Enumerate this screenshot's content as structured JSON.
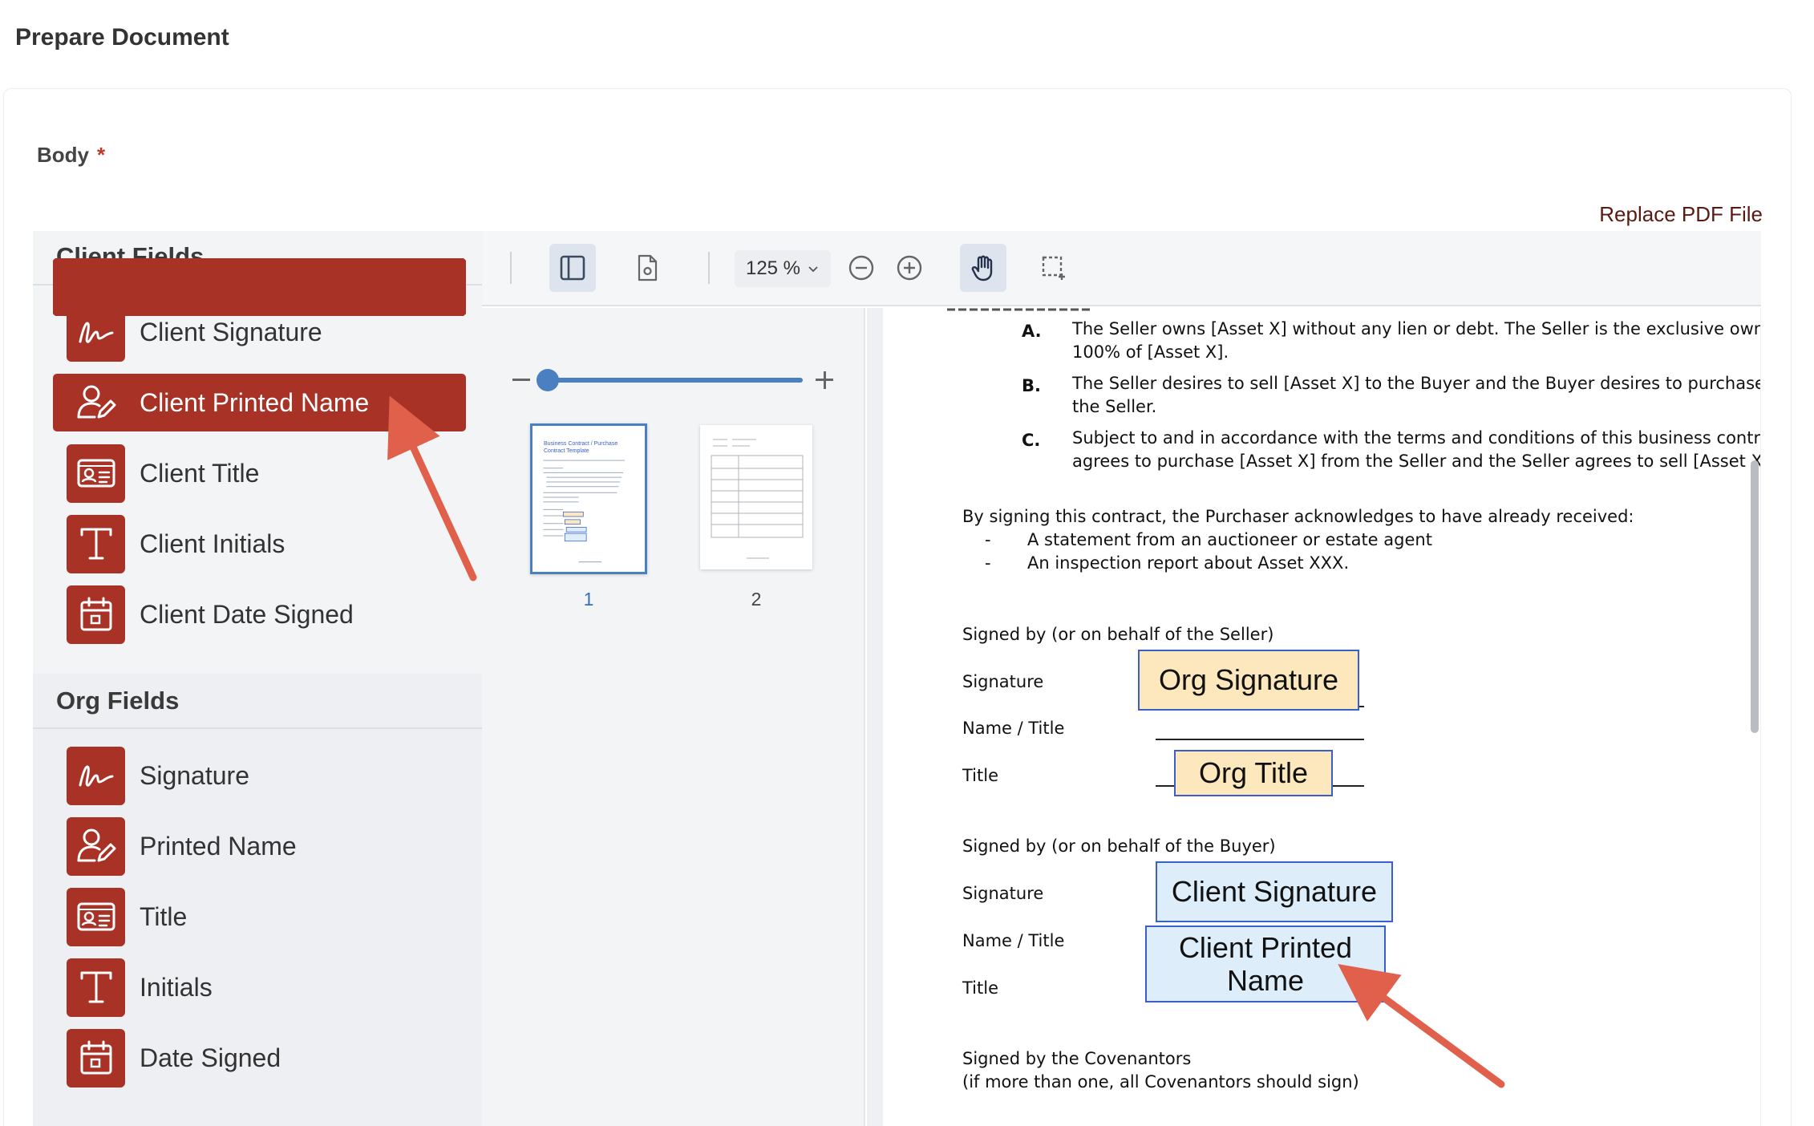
{
  "page": {
    "title": "Prepare Document"
  },
  "form": {
    "body_label": "Body",
    "required_mark": "*",
    "replace_pdf_label": "Replace PDF File"
  },
  "client_fields": {
    "title": "Client Fields",
    "items": [
      {
        "label": "Client Signature",
        "icon": "signature-icon"
      },
      {
        "label": "Client Printed Name",
        "icon": "user-pen-icon",
        "active": true
      },
      {
        "label": "Client Title",
        "icon": "id-card-icon"
      },
      {
        "label": "Client Initials",
        "icon": "text-t-icon"
      },
      {
        "label": "Client Date Signed",
        "icon": "calendar-icon"
      }
    ]
  },
  "org_fields": {
    "title": "Org Fields",
    "items": [
      {
        "label": "Signature",
        "icon": "signature-icon"
      },
      {
        "label": "Printed Name",
        "icon": "user-pen-icon"
      },
      {
        "label": "Title",
        "icon": "id-card-icon"
      },
      {
        "label": "Initials",
        "icon": "text-t-icon"
      },
      {
        "label": "Date Signed",
        "icon": "calendar-icon"
      }
    ]
  },
  "toolbar": {
    "zoom_label": "125 %",
    "icons": [
      "sidebar-toggle-icon",
      "document-settings-icon",
      "zoom-out-icon",
      "zoom-in-icon",
      "hand-pan-icon",
      "marquee-select-icon"
    ]
  },
  "thumbnails": {
    "pages": [
      {
        "number": "1",
        "selected": true,
        "heading": "Business Contract / Purchase Contract Template"
      },
      {
        "number": "2",
        "selected": false
      }
    ]
  },
  "document": {
    "recitals": [
      {
        "letter": "A.",
        "lines": [
          "The Seller owns [Asset X] without any lien or debt. The Seller is the exclusive owner ar",
          "100% of [Asset X]."
        ]
      },
      {
        "letter": "B.",
        "lines": [
          "The Seller desires to sell [Asset X] to the Buyer and the Buyer desires to purchase [Ass",
          "the Seller."
        ]
      },
      {
        "letter": "C.",
        "lines": [
          "Subject to and in accordance with the terms and conditions of this business contract, t",
          "agrees to purchase [Asset X] from the Seller and the Seller agrees to sell [Asset X] to th"
        ]
      }
    ],
    "acknowledge_text": "By signing this contract, the Purchaser acknowledges to have already received:",
    "bullets": [
      "A statement from an auctioneer or estate agent",
      "An inspection report about Asset XXX."
    ],
    "seller_heading": "Signed by (or on behalf of the Seller)",
    "buyer_heading": "Signed by (or on behalf of the Buyer)",
    "row_labels": {
      "signature": "Signature",
      "name_title": "Name / Title",
      "title": "Title"
    },
    "placed_fields": {
      "org_signature": "Org Signature",
      "org_title": "Org Title",
      "client_signature": "Client Signature",
      "client_printed_name": "Client Printed Name"
    },
    "covenantors_heading": "Signed by the Covenantors",
    "covenantors_note": "(if more than one, all Covenantors should sign)"
  },
  "colors": {
    "accent": "#a93226",
    "org_field_fill": "#fde8be",
    "client_field_fill": "#ddeefa",
    "field_border": "#3b5ec9",
    "annotation_arrow": "#e0604c"
  }
}
